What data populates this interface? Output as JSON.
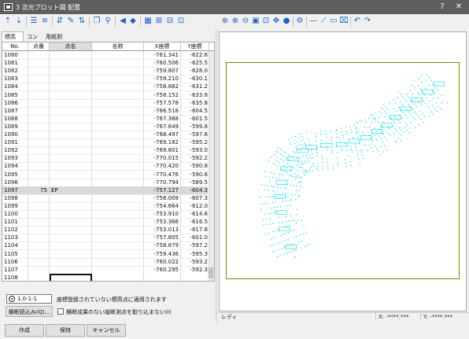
{
  "window": {
    "title": "3 次元プロット図 配置",
    "help_label": "?",
    "close_label": "✕"
  },
  "tabs": [
    {
      "label": "標高点",
      "active": true
    },
    {
      "label": "コンタ",
      "active": false
    },
    {
      "label": "用紙割付",
      "active": false
    }
  ],
  "table": {
    "columns": [
      "No.",
      "点番",
      "点名",
      "名称",
      "X座標",
      "Y座標"
    ],
    "rows": [
      {
        "no": "1080",
        "ten_ban": "",
        "ten_mei": "",
        "meisho": "",
        "x": "-761.341",
        "y": "-622.6"
      },
      {
        "no": "1081",
        "ten_ban": "",
        "ten_mei": "",
        "meisho": "",
        "x": "-760.506",
        "y": "-625.5"
      },
      {
        "no": "1082",
        "ten_ban": "",
        "ten_mei": "",
        "meisho": "",
        "x": "-759.807",
        "y": "-628.0"
      },
      {
        "no": "1083",
        "ten_ban": "",
        "ten_mei": "",
        "meisho": "",
        "x": "-759.210",
        "y": "-630.1"
      },
      {
        "no": "1084",
        "ten_ban": "",
        "ten_mei": "",
        "meisho": "",
        "x": "-758.882",
        "y": "-631.2"
      },
      {
        "no": "1085",
        "ten_ban": "",
        "ten_mei": "",
        "meisho": "",
        "x": "-758.152",
        "y": "-633.8"
      },
      {
        "no": "1086",
        "ten_ban": "",
        "ten_mei": "",
        "meisho": "",
        "x": "-757.578",
        "y": "-635.8"
      },
      {
        "no": "1087",
        "ten_ban": "",
        "ten_mei": "",
        "meisho": "",
        "x": "-766.518",
        "y": "-604.5"
      },
      {
        "no": "1088",
        "ten_ban": "",
        "ten_mei": "",
        "meisho": "",
        "x": "-767.368",
        "y": "-601.5"
      },
      {
        "no": "1089",
        "ten_ban": "",
        "ten_mei": "",
        "meisho": "",
        "x": "-767.849",
        "y": "-599.8"
      },
      {
        "no": "1090",
        "ten_ban": "",
        "ten_mei": "",
        "meisho": "",
        "x": "-768.497",
        "y": "-597.6"
      },
      {
        "no": "1091",
        "ten_ban": "",
        "ten_mei": "",
        "meisho": "",
        "x": "-769.182",
        "y": "-595.2"
      },
      {
        "no": "1092",
        "ten_ban": "",
        "ten_mei": "",
        "meisho": "",
        "x": "-769.801",
        "y": "-593.0"
      },
      {
        "no": "1093",
        "ten_ban": "",
        "ten_mei": "",
        "meisho": "",
        "x": "-770.015",
        "y": "-592.2"
      },
      {
        "no": "1094",
        "ten_ban": "",
        "ten_mei": "",
        "meisho": "",
        "x": "-770.420",
        "y": "-590.8"
      },
      {
        "no": "1095",
        "ten_ban": "",
        "ten_mei": "",
        "meisho": "",
        "x": "-770.476",
        "y": "-590.6"
      },
      {
        "no": "1096",
        "ten_ban": "",
        "ten_mei": "",
        "meisho": "",
        "x": "-770.794",
        "y": "-589.5"
      },
      {
        "no": "1097",
        "ten_ban": "75",
        "ten_mei": "EP",
        "meisho": "",
        "x": "-757.127",
        "y": "-604.3",
        "selected": true
      },
      {
        "no": "1098",
        "ten_ban": "",
        "ten_mei": "",
        "meisho": "",
        "x": "-756.009",
        "y": "-607.3"
      },
      {
        "no": "1099",
        "ten_ban": "",
        "ten_mei": "",
        "meisho": "",
        "x": "-754.664",
        "y": "-612.0"
      },
      {
        "no": "1100",
        "ten_ban": "",
        "ten_mei": "",
        "meisho": "",
        "x": "-753.910",
        "y": "-614.6"
      },
      {
        "no": "1101",
        "ten_ban": "",
        "ten_mei": "",
        "meisho": "",
        "x": "-753.366",
        "y": "-616.5"
      },
      {
        "no": "1102",
        "ten_ban": "",
        "ten_mei": "",
        "meisho": "",
        "x": "-753.013",
        "y": "-617.8"
      },
      {
        "no": "1103",
        "ten_ban": "",
        "ten_mei": "",
        "meisho": "",
        "x": "-757.805",
        "y": "-601.0"
      },
      {
        "no": "1104",
        "ten_ban": "",
        "ten_mei": "",
        "meisho": "",
        "x": "-758.879",
        "y": "-597.2"
      },
      {
        "no": "1105",
        "ten_ban": "",
        "ten_mei": "",
        "meisho": "",
        "x": "-759.436",
        "y": "-595.3"
      },
      {
        "no": "1106",
        "ten_ban": "",
        "ten_mei": "",
        "meisho": "",
        "x": "-760.022",
        "y": "-593.2"
      },
      {
        "no": "1107",
        "ten_ban": "",
        "ten_mei": "",
        "meisho": "",
        "x": "-760.295",
        "y": "-592.3"
      },
      {
        "no": "1108",
        "ten_ban": "",
        "ten_mei": "",
        "meisho": "",
        "x": "",
        "y": "",
        "editing": true
      }
    ]
  },
  "options": {
    "code_value": "1.0-1-1",
    "code_desc": "座標登録されていない標高点に適用されます",
    "cross_read_label": "横断読込み(Q)...",
    "no_cross_label": "横断成果のない縦断測点を取り込まない(I)",
    "no_cross_checked": false
  },
  "statusbar": {
    "mode": "レディ",
    "x_readout": "X: -****.***",
    "y_readout": "Y: -****.***"
  },
  "buttons": {
    "create": "作成",
    "save": "保持",
    "cancel": "キャンセル"
  },
  "colors": {
    "plot_points": "#00d8e8",
    "frame": "#8c8000",
    "titlebar": "#5e5e5e"
  }
}
